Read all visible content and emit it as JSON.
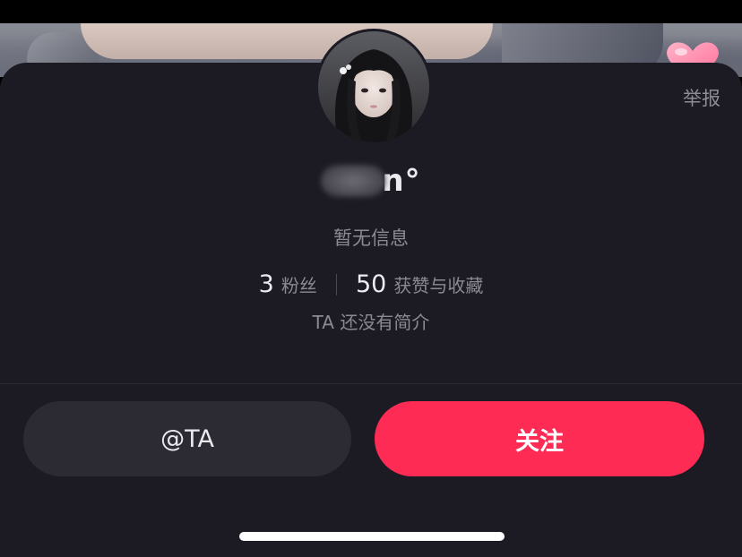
{
  "sheet": {
    "report_label": "举报",
    "username_visible": "n°",
    "info_text": "暂无信息",
    "stats": [
      {
        "value": "3",
        "label": "粉丝"
      },
      {
        "value": "50",
        "label": "获赞与收藏"
      }
    ],
    "bio": "TA 还没有简介",
    "mention_button": "@TA",
    "follow_button": "关注"
  },
  "colors": {
    "sheet_bg": "#1c1b24",
    "accent": "#fe2c55",
    "secondary_button": "#2c2b33",
    "muted_text": "#8b8a92"
  },
  "icons": {
    "avatar": "profile-avatar",
    "sticker": "heart-sticker-icon"
  }
}
